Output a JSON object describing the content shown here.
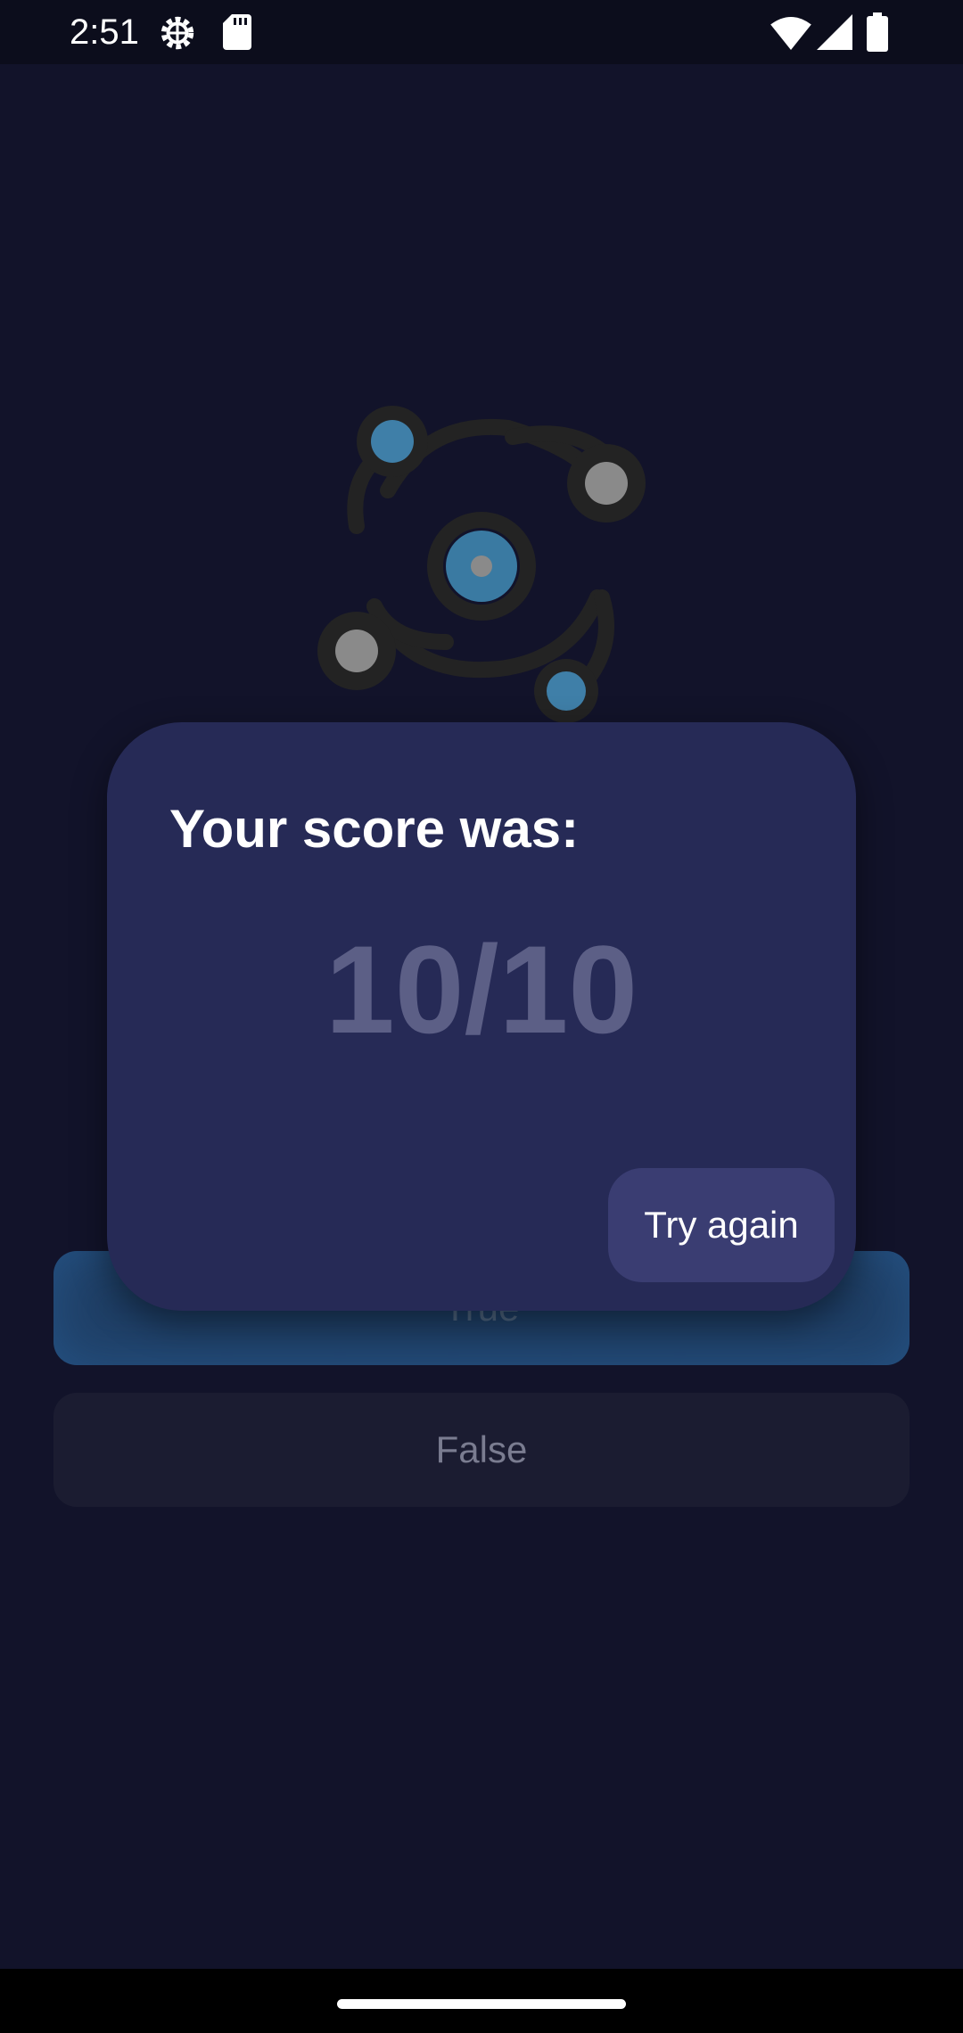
{
  "status_bar": {
    "time": "2:51",
    "icons": [
      "gear-icon",
      "sd-card-icon",
      "wifi-icon",
      "cell-signal-icon",
      "battery-icon"
    ]
  },
  "quiz": {
    "true_label": "True",
    "false_label": "False"
  },
  "dialog": {
    "title": "Your score was:",
    "score": "10/10",
    "try_again_label": "Try again"
  },
  "colors": {
    "background": "#12132a",
    "dialog": "#262a56",
    "accent_button": "#3a3d72",
    "true_button": "#1f3f66",
    "score_text": "#5c5f86",
    "atom_blue": "#3f7fa8",
    "atom_gray": "#8a8a8a"
  }
}
